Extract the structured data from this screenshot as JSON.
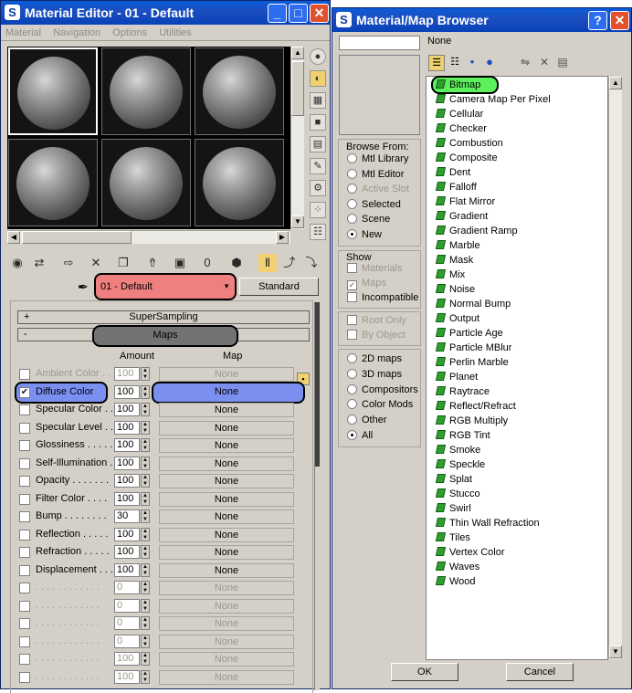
{
  "material_editor": {
    "title": "Material Editor - 01 - Default",
    "menu": [
      "Material",
      "Navigation",
      "Options",
      "Utilities"
    ],
    "material_name": "01 - Default",
    "material_type": "Standard",
    "rollouts": {
      "supersampling": "SuperSampling",
      "maps": "Maps"
    },
    "columns": {
      "amount": "Amount",
      "map": "Map"
    },
    "maps": [
      {
        "label": "Ambient Color . .",
        "amount": "100",
        "map": "None",
        "checked": false,
        "disabled": true
      },
      {
        "label": "Diffuse Color",
        "amount": "100",
        "map": "None",
        "checked": true,
        "disabled": false
      },
      {
        "label": "Specular Color . .",
        "amount": "100",
        "map": "None",
        "checked": false,
        "disabled": false
      },
      {
        "label": "Specular Level . .",
        "amount": "100",
        "map": "None",
        "checked": false,
        "disabled": false
      },
      {
        "label": "Glossiness . . . . .",
        "amount": "100",
        "map": "None",
        "checked": false,
        "disabled": false
      },
      {
        "label": "Self-Illumination .",
        "amount": "100",
        "map": "None",
        "checked": false,
        "disabled": false
      },
      {
        "label": "Opacity . . . . . . .",
        "amount": "100",
        "map": "None",
        "checked": false,
        "disabled": false
      },
      {
        "label": "Filter Color . . . .",
        "amount": "100",
        "map": "None",
        "checked": false,
        "disabled": false
      },
      {
        "label": "Bump . . . . . . . .",
        "amount": "30",
        "map": "None",
        "checked": false,
        "disabled": false
      },
      {
        "label": "Reflection . . . . .",
        "amount": "100",
        "map": "None",
        "checked": false,
        "disabled": false
      },
      {
        "label": "Refraction . . . . .",
        "amount": "100",
        "map": "None",
        "checked": false,
        "disabled": false
      },
      {
        "label": "Displacement . . .",
        "amount": "100",
        "map": "None",
        "checked": false,
        "disabled": false
      },
      {
        "label": ". . . . . . . . . . . .",
        "amount": "0",
        "map": "None",
        "checked": false,
        "disabled": true
      },
      {
        "label": ". . . . . . . . . . . .",
        "amount": "0",
        "map": "None",
        "checked": false,
        "disabled": true
      },
      {
        "label": ". . . . . . . . . . . .",
        "amount": "0",
        "map": "None",
        "checked": false,
        "disabled": true
      },
      {
        "label": ". . . . . . . . . . . .",
        "amount": "0",
        "map": "None",
        "checked": false,
        "disabled": true
      },
      {
        "label": ". . . . . . . . . . . .",
        "amount": "100",
        "map": "None",
        "checked": false,
        "disabled": true
      },
      {
        "label": ". . . . . . . . . . . .",
        "amount": "100",
        "map": "None",
        "checked": false,
        "disabled": true
      }
    ]
  },
  "browser": {
    "title": "Material/Map Browser",
    "name_field": "None",
    "browse_from": {
      "title": "Browse From:",
      "options": [
        {
          "label": "Mtl Library",
          "selected": false,
          "disabled": false
        },
        {
          "label": "Mtl Editor",
          "selected": false,
          "disabled": false
        },
        {
          "label": "Active Slot",
          "selected": false,
          "disabled": true
        },
        {
          "label": "Selected",
          "selected": false,
          "disabled": false
        },
        {
          "label": "Scene",
          "selected": false,
          "disabled": false
        },
        {
          "label": "New",
          "selected": true,
          "disabled": false
        }
      ]
    },
    "show": {
      "title": "Show",
      "options": [
        {
          "label": "Materials",
          "checked": false,
          "disabled": true
        },
        {
          "label": "Maps",
          "checked": true,
          "disabled": true
        },
        {
          "label": "Incompatible",
          "checked": false,
          "disabled": false
        }
      ]
    },
    "root": [
      {
        "label": "Root Only",
        "checked": false,
        "disabled": true
      },
      {
        "label": "By Object",
        "checked": false,
        "disabled": true
      }
    ],
    "categories": [
      {
        "label": "2D maps",
        "selected": false
      },
      {
        "label": "3D maps",
        "selected": false
      },
      {
        "label": "Compositors",
        "selected": false
      },
      {
        "label": "Color Mods",
        "selected": false
      },
      {
        "label": "Other",
        "selected": false
      },
      {
        "label": "All",
        "selected": true
      }
    ],
    "maps": [
      "Bitmap",
      "Camera Map Per Pixel",
      "Cellular",
      "Checker",
      "Combustion",
      "Composite",
      "Dent",
      "Falloff",
      "Flat Mirror",
      "Gradient",
      "Gradient Ramp",
      "Marble",
      "Mask",
      "Mix",
      "Noise",
      "Normal Bump",
      "Output",
      "Particle Age",
      "Particle MBlur",
      "Perlin Marble",
      "Planet",
      "Raytrace",
      "Reflect/Refract",
      "RGB Multiply",
      "RGB Tint",
      "Smoke",
      "Speckle",
      "Splat",
      "Stucco",
      "Swirl",
      "Thin Wall Refraction",
      "Tiles",
      "Vertex Color",
      "Waves",
      "Wood"
    ],
    "ok_label": "OK",
    "cancel_label": "Cancel"
  },
  "highlight_colors": {
    "red": "#f08080",
    "blue": "#7a8ff0",
    "green": "#5cf05c",
    "grey": "#737373"
  }
}
